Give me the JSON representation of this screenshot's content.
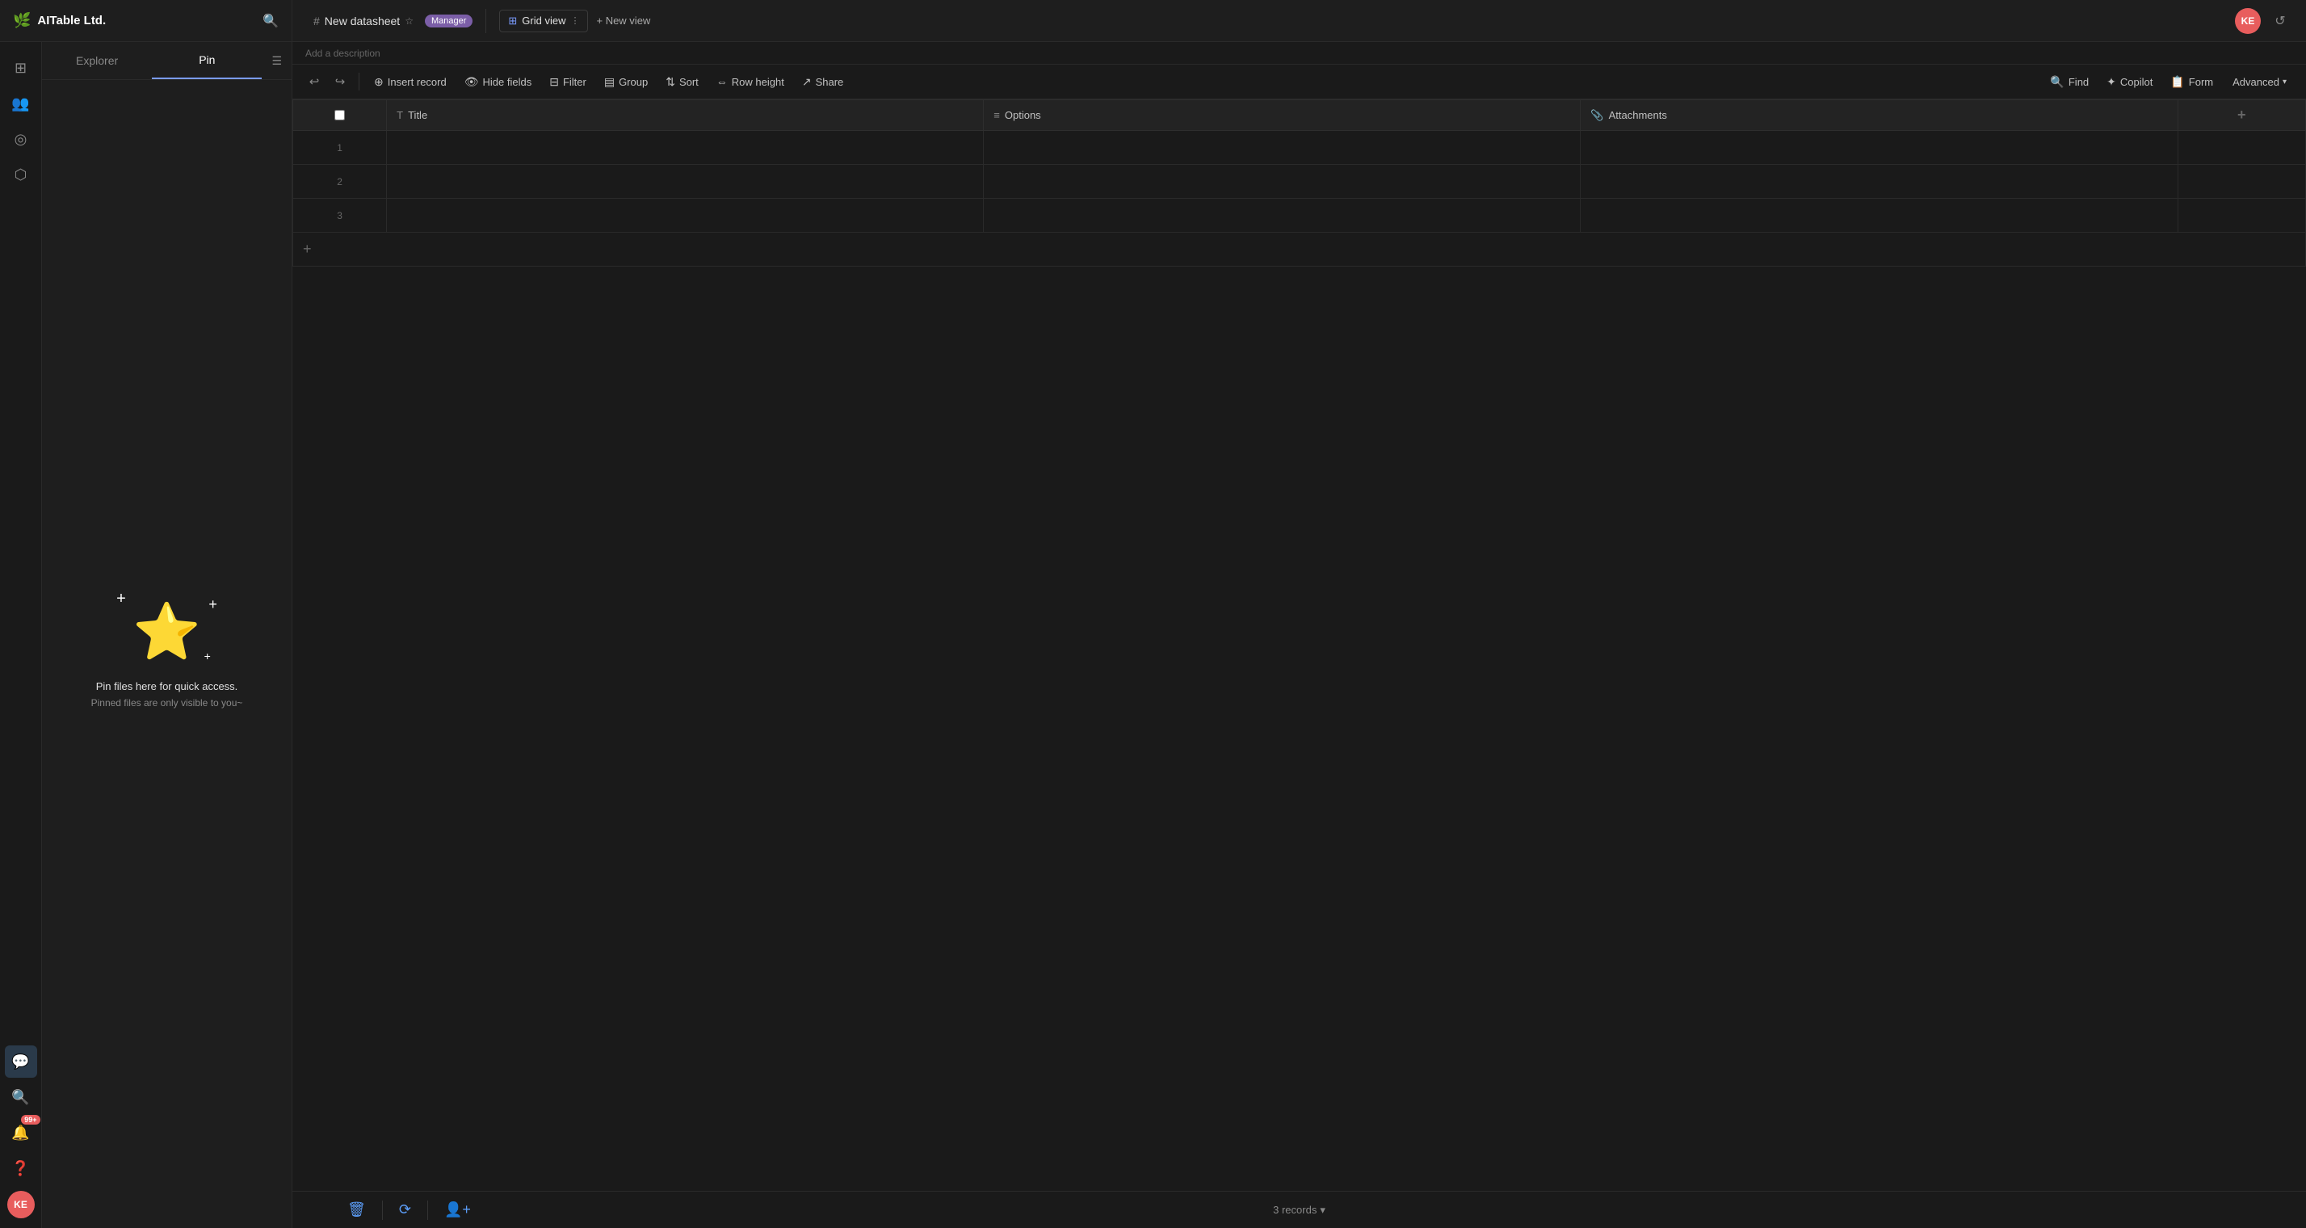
{
  "app": {
    "logo": "AITable Ltd.",
    "logo_emoji": "🌿"
  },
  "topbar": {
    "search_title": "Search",
    "tab_name": "New datasheet",
    "tab_icon": "#",
    "manager_label": "Manager",
    "add_description": "Add a description",
    "view_label": "Grid view",
    "new_view_label": "+ New view",
    "user_initials": "KE"
  },
  "sidebar": {
    "explorer_label": "Explorer",
    "pin_label": "Pin",
    "pin_message_line1": "Pin files here for quick access.",
    "pin_message_line2": "Pinned files are only visible to you~"
  },
  "toolbar": {
    "undo_label": "",
    "redo_label": "",
    "insert_record_label": "Insert record",
    "hide_fields_label": "Hide fields",
    "filter_label": "Filter",
    "group_label": "Group",
    "sort_label": "Sort",
    "row_height_label": "Row height",
    "share_label": "Share",
    "find_label": "Find",
    "copilot_label": "Copilot",
    "form_label": "Form",
    "advanced_label": "Advanced"
  },
  "grid": {
    "columns": [
      {
        "id": "checkbox",
        "label": ""
      },
      {
        "id": "title",
        "label": "Title",
        "icon": "text"
      },
      {
        "id": "options",
        "label": "Options",
        "icon": "list"
      },
      {
        "id": "attachments",
        "label": "Attachments",
        "icon": "paperclip"
      },
      {
        "id": "add",
        "label": "+"
      }
    ],
    "rows": [
      {
        "num": "1"
      },
      {
        "num": "2"
      },
      {
        "num": "3"
      }
    ]
  },
  "bottombar": {
    "records_count": "3 records",
    "records_caret": "▾"
  },
  "nav_icons": {
    "home": "⊞",
    "users": "👥",
    "target": "◎",
    "shield": "⬡",
    "chat": "💬",
    "search": "🔍",
    "bell": "🔔",
    "help": "❓",
    "notification_count": "99+"
  }
}
